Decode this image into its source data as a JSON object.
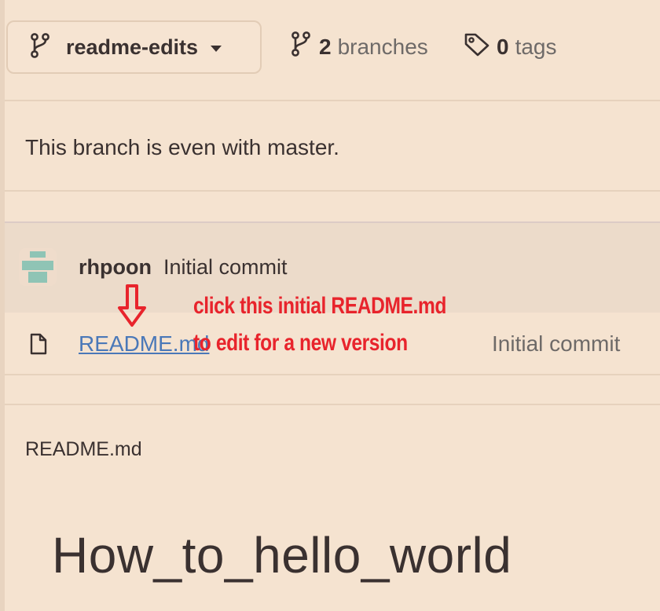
{
  "toolbar": {
    "branch_name": "readme-edits",
    "branches_count": "2",
    "branches_label": "branches",
    "tags_count": "0",
    "tags_label": "tags"
  },
  "status": {
    "message": "This branch is even with master."
  },
  "latest_commit": {
    "author": "rhpoon",
    "message": "Initial commit"
  },
  "files": [
    {
      "name": "README.md",
      "commit_message": "Initial commit",
      "icon": "file-icon"
    }
  ],
  "annotation": {
    "line1": "click this initial README.md",
    "line2": "to edit for a new version",
    "color": "#e8242c",
    "icon": "down-arrow"
  },
  "readme": {
    "label": "README.md",
    "heading": "How_to_hello_world"
  },
  "colors": {
    "background": "#f5e3d0",
    "commit_band": "#ecdbca",
    "link": "#4a78b8",
    "text": "#3a3130",
    "muted_text": "#6e6a68"
  }
}
